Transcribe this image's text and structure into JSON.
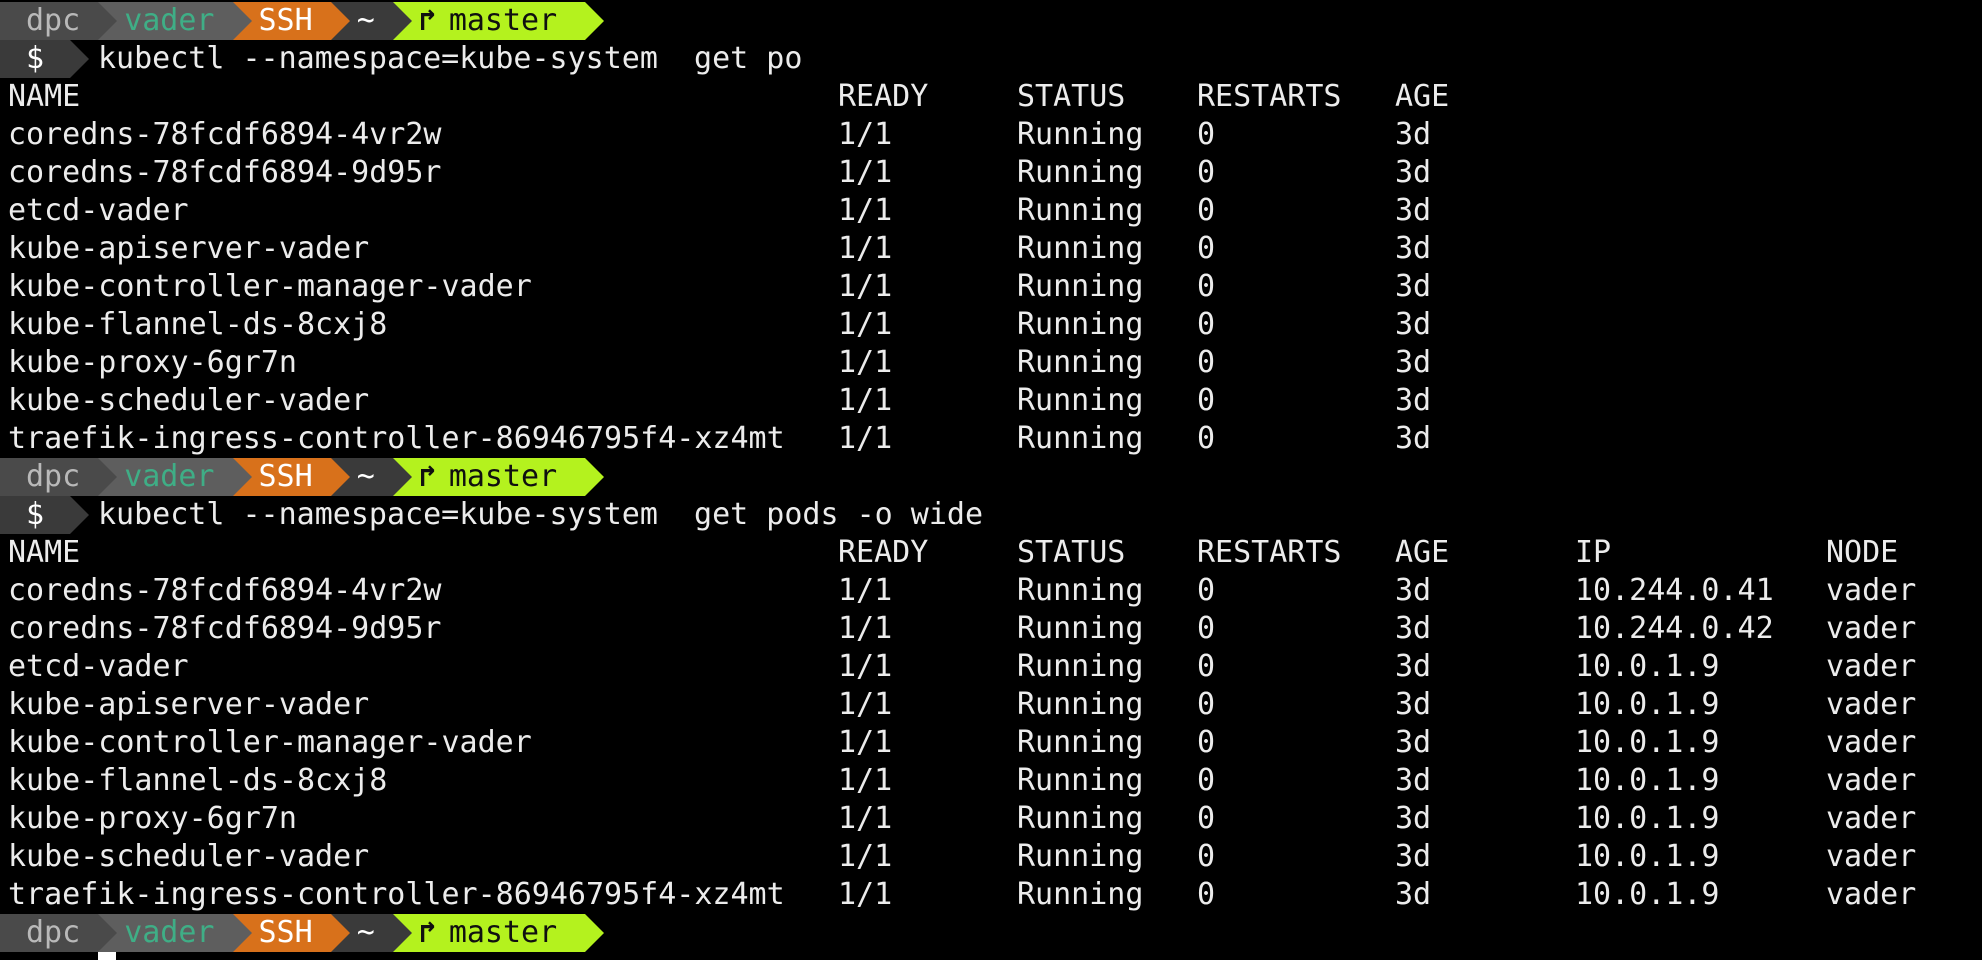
{
  "prompt": {
    "user": "dpc",
    "host": "vader",
    "ssh": "SSH",
    "dir": "~",
    "branch_icon": "↱",
    "branch": "master",
    "symbol": "$"
  },
  "commands": [
    "kubectl --namespace=kube-system  get po",
    "kubectl --namespace=kube-system  get pods -o wide"
  ],
  "table1": {
    "headers": [
      "NAME",
      "READY",
      "STATUS",
      "RESTARTS",
      "AGE"
    ],
    "rows": [
      [
        "coredns-78fcdf6894-4vr2w",
        "1/1",
        "Running",
        "0",
        "3d"
      ],
      [
        "coredns-78fcdf6894-9d95r",
        "1/1",
        "Running",
        "0",
        "3d"
      ],
      [
        "etcd-vader",
        "1/1",
        "Running",
        "0",
        "3d"
      ],
      [
        "kube-apiserver-vader",
        "1/1",
        "Running",
        "0",
        "3d"
      ],
      [
        "kube-controller-manager-vader",
        "1/1",
        "Running",
        "0",
        "3d"
      ],
      [
        "kube-flannel-ds-8cxj8",
        "1/1",
        "Running",
        "0",
        "3d"
      ],
      [
        "kube-proxy-6gr7n",
        "1/1",
        "Running",
        "0",
        "3d"
      ],
      [
        "kube-scheduler-vader",
        "1/1",
        "Running",
        "0",
        "3d"
      ],
      [
        "traefik-ingress-controller-86946795f4-xz4mt",
        "1/1",
        "Running",
        "0",
        "3d"
      ]
    ]
  },
  "table2": {
    "headers": [
      "NAME",
      "READY",
      "STATUS",
      "RESTARTS",
      "AGE",
      "IP",
      "NODE"
    ],
    "rows": [
      [
        "coredns-78fcdf6894-4vr2w",
        "1/1",
        "Running",
        "0",
        "3d",
        "10.244.0.41",
        "vader"
      ],
      [
        "coredns-78fcdf6894-9d95r",
        "1/1",
        "Running",
        "0",
        "3d",
        "10.244.0.42",
        "vader"
      ],
      [
        "etcd-vader",
        "1/1",
        "Running",
        "0",
        "3d",
        "10.0.1.9",
        "vader"
      ],
      [
        "kube-apiserver-vader",
        "1/1",
        "Running",
        "0",
        "3d",
        "10.0.1.9",
        "vader"
      ],
      [
        "kube-controller-manager-vader",
        "1/1",
        "Running",
        "0",
        "3d",
        "10.0.1.9",
        "vader"
      ],
      [
        "kube-flannel-ds-8cxj8",
        "1/1",
        "Running",
        "0",
        "3d",
        "10.0.1.9",
        "vader"
      ],
      [
        "kube-proxy-6gr7n",
        "1/1",
        "Running",
        "0",
        "3d",
        "10.0.1.9",
        "vader"
      ],
      [
        "kube-scheduler-vader",
        "1/1",
        "Running",
        "0",
        "3d",
        "10.0.1.9",
        "vader"
      ],
      [
        "traefik-ingress-controller-86946795f4-xz4mt",
        "1/1",
        "Running",
        "0",
        "3d",
        "10.0.1.9",
        "vader"
      ]
    ]
  },
  "colors": {
    "background": "#000000",
    "text": "#ececec",
    "user_segment": "#4a4a4a",
    "host_segment": "#5e5e5e",
    "host_text": "#3fae86",
    "ssh_segment": "#d8711b",
    "dir_segment": "#3a3a3a",
    "git_segment": "#b4f21e"
  }
}
